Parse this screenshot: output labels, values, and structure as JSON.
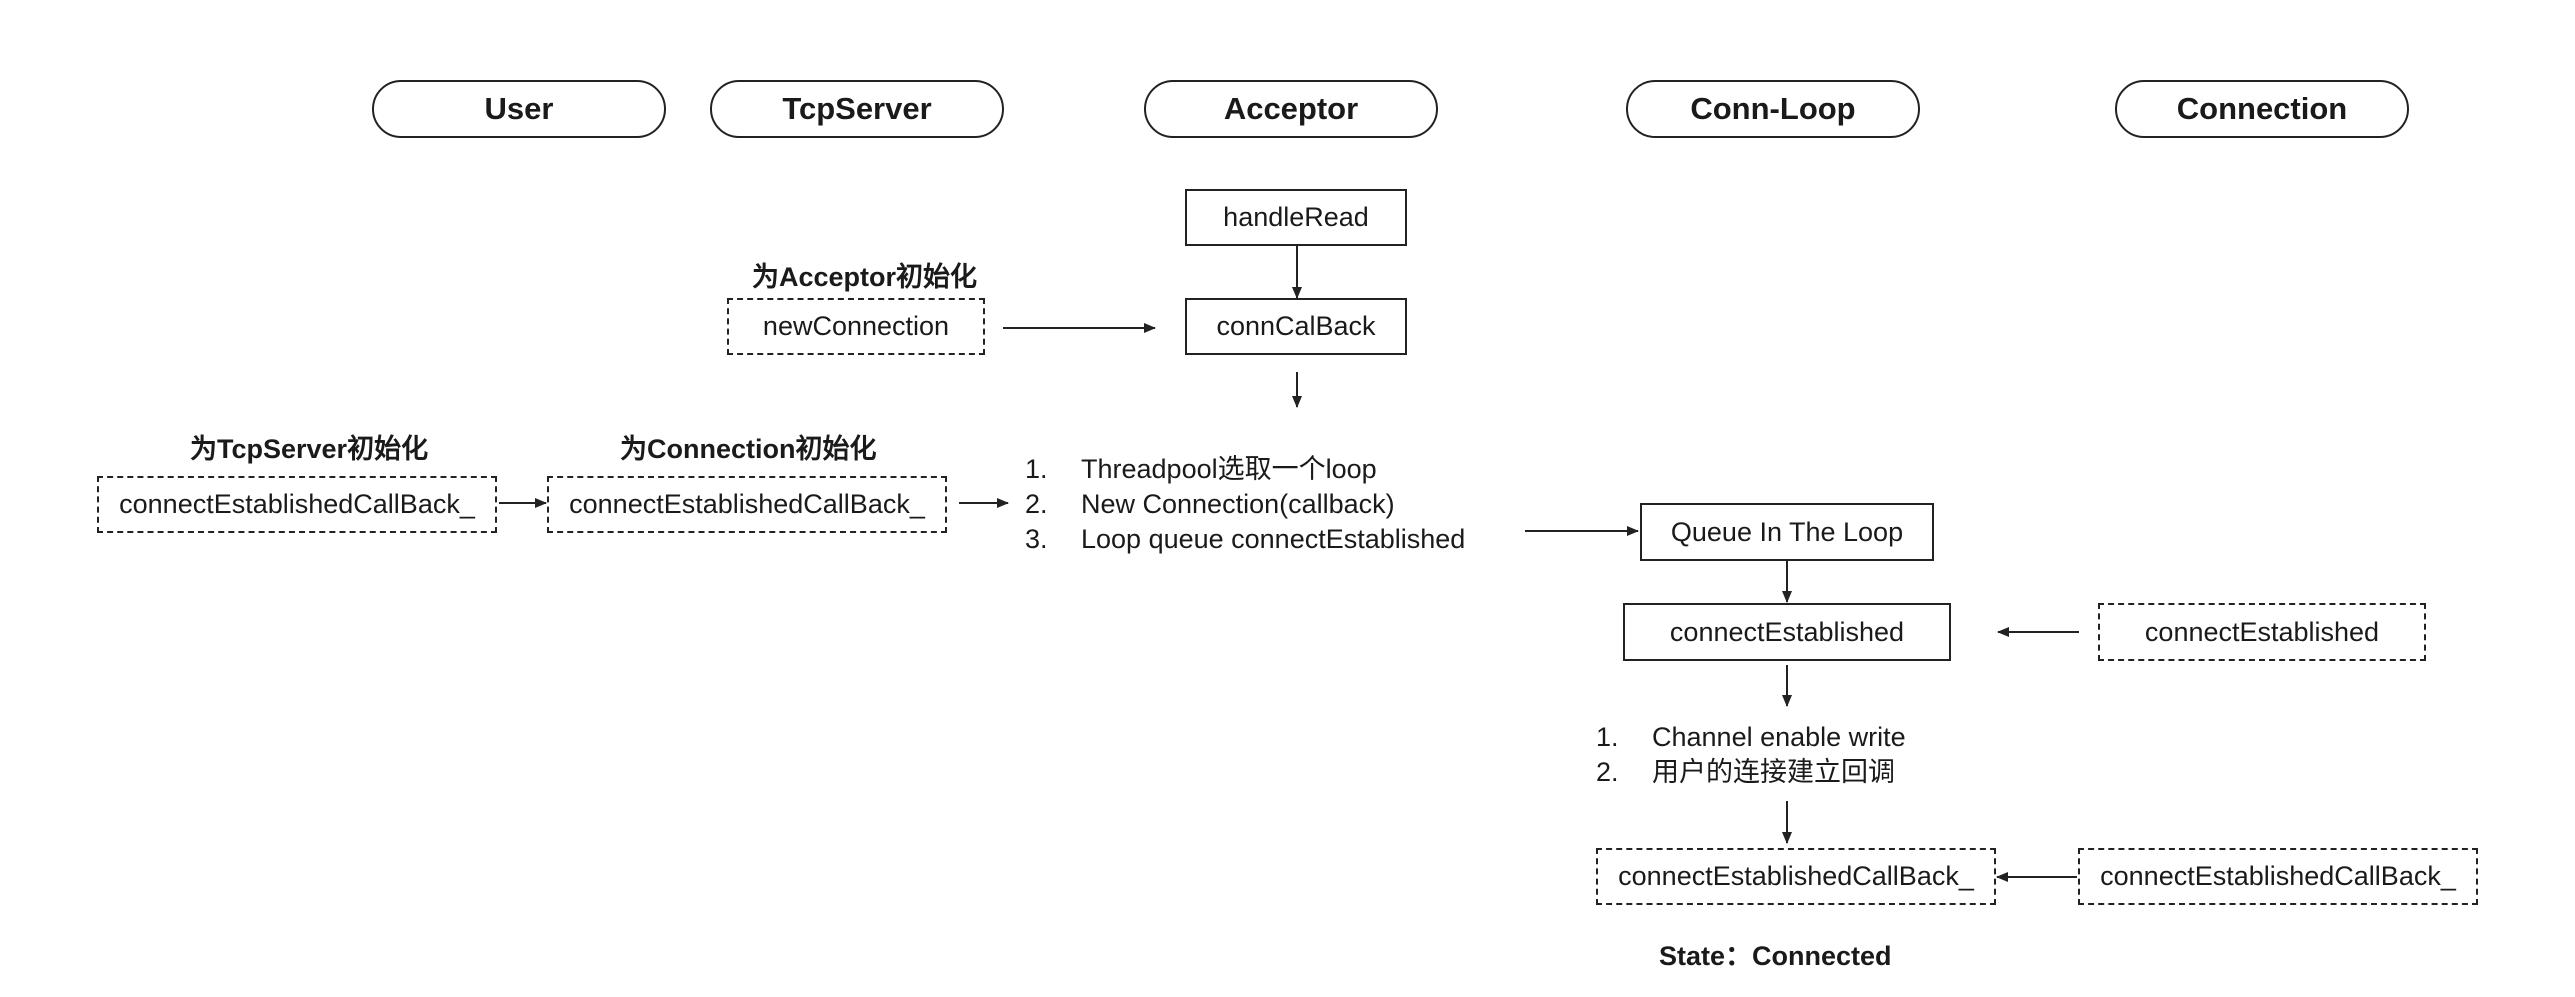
{
  "lanes": {
    "user": "User",
    "tcpserver": "TcpServer",
    "acceptor": "Acceptor",
    "connloop": "Conn-Loop",
    "connection": "Connection"
  },
  "labels": {
    "init_acceptor": "为Acceptor初始化",
    "init_tcpserver": "为TcpServer初始化",
    "init_connection": "为Connection初始化",
    "state": "State：Connected"
  },
  "boxes": {
    "handle_read": "handleRead",
    "new_connection": "newConnection",
    "conn_callback": "connCalBack",
    "user_cb": "connectEstablishedCallBack_",
    "tcpserver_cb": "connectEstablishedCallBack_",
    "queue_in_loop": "Queue In The Loop",
    "loop_connect_established": "connectEstablished",
    "connection_connect_established": "connectEstablished",
    "loop_cb": "connectEstablishedCallBack_",
    "connection_cb": "connectEstablishedCallBack_"
  },
  "steps_acceptor": [
    {
      "num": "1.",
      "text": "Threadpool选取一个loop"
    },
    {
      "num": "2.",
      "text": "New Connection(callback)"
    },
    {
      "num": "3.",
      "text": "Loop queue connectEstablished"
    }
  ],
  "steps_loop": [
    {
      "num": "1.",
      "text": "Channel enable write"
    },
    {
      "num": "2.",
      "text": "用户的连接建立回调"
    }
  ]
}
